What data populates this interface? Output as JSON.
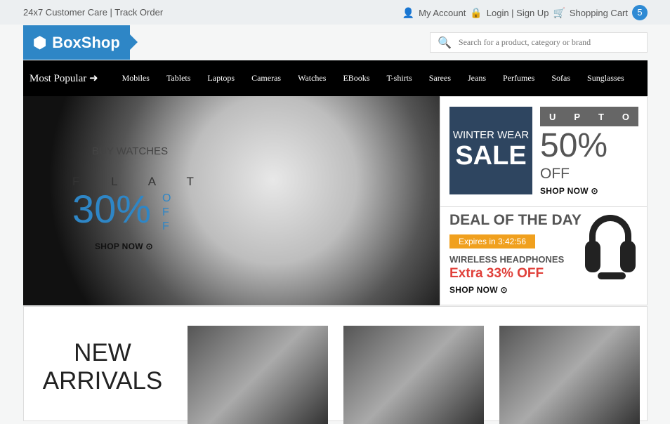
{
  "topbar": {
    "left": "24x7 Customer Care | Track Order",
    "account": "My Account",
    "login": "Login | Sign Up",
    "cart": "Shopping Cart",
    "cart_count": "5"
  },
  "logo": {
    "text": "BoxShop"
  },
  "search": {
    "placeholder": "Search for a product, category or brand"
  },
  "nav": {
    "most_popular": "Most Popular",
    "items": [
      "Mobiles",
      "Tablets",
      "Laptops",
      "Cameras",
      "Watches",
      "EBooks",
      "T-shirts",
      "Sarees",
      "Jeans",
      "Perfumes",
      "Sofas",
      "Sunglasses"
    ]
  },
  "hero": {
    "buy": "BUY WATCHES",
    "flat": "F L A T",
    "percent": "30%",
    "off": "OFF",
    "shop": "SHOP NOW"
  },
  "sale": {
    "line1": "WINTER WEAR",
    "line2": "SALE",
    "upto": [
      "U",
      "P",
      "T",
      "O"
    ],
    "percent": "50%",
    "off": "OFF",
    "shop": "SHOP NOW"
  },
  "deal": {
    "title": "DEAL OF THE DAY",
    "expires": "Expires in 3:42:56",
    "product": "WIRELESS HEADPHONES",
    "offer": "Extra 33% OFF",
    "shop": "SHOP NOW"
  },
  "arrivals": {
    "line1": "NEW",
    "line2": "ARRIVALS"
  },
  "colors": {
    "brand": "#2e86c6",
    "sale_bg": "#2e4560",
    "timer": "#f0a01e",
    "offer": "#e0403a"
  }
}
